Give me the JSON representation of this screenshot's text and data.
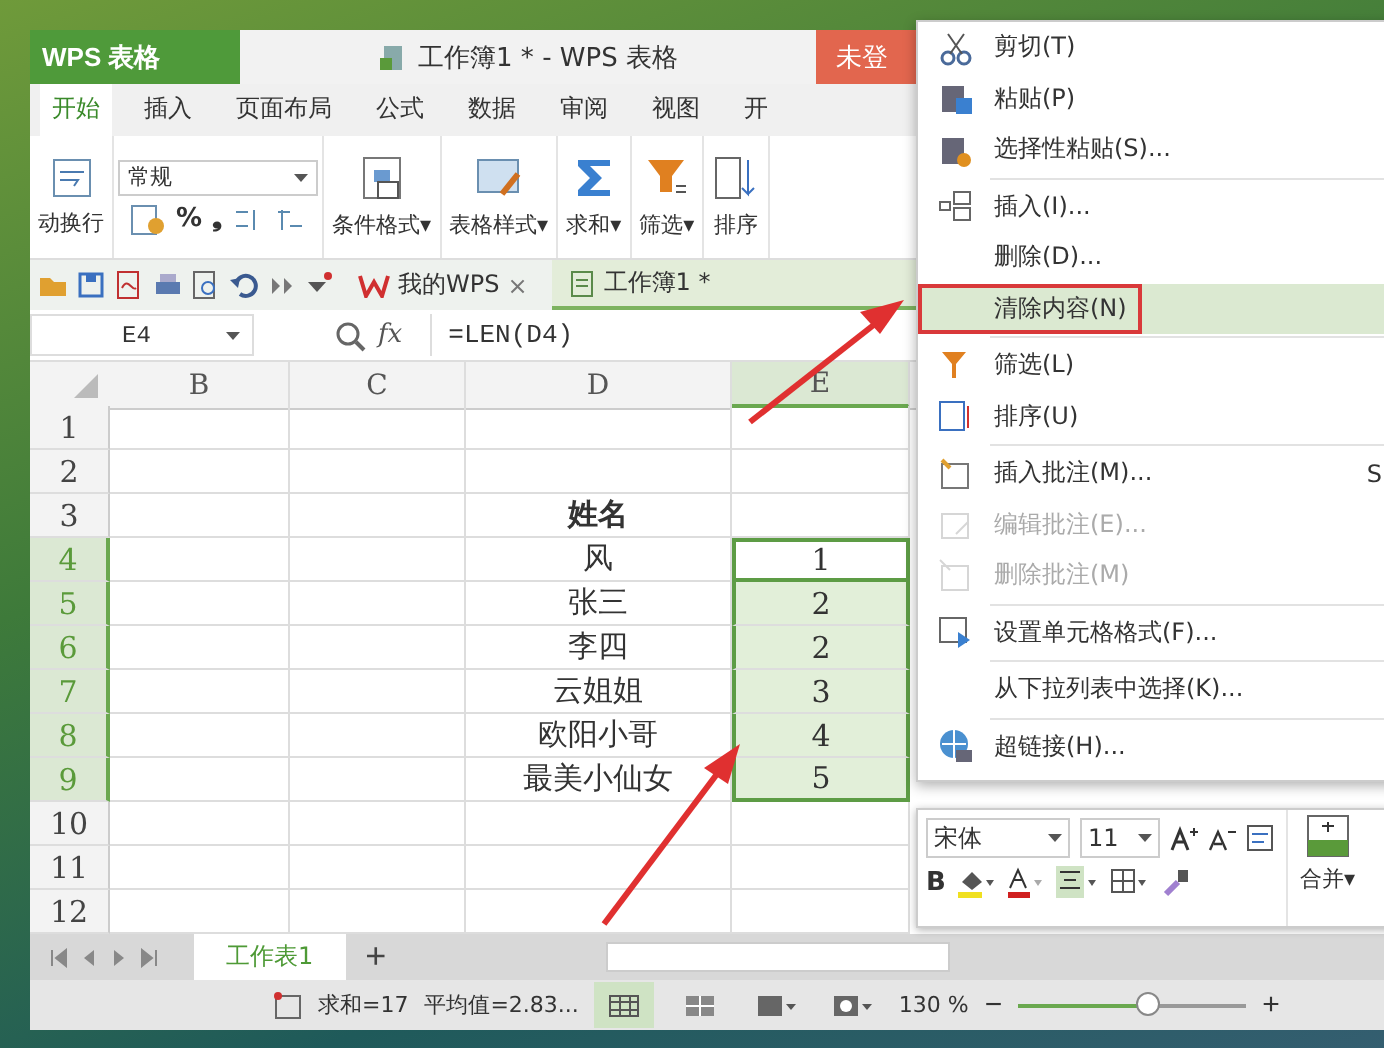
{
  "app": {
    "name": "WPS 表格",
    "title": "工作簿1 * - WPS 表格",
    "login": "未登"
  },
  "ribbon_tabs": [
    {
      "label": "开始",
      "selected": true
    },
    {
      "label": "插入",
      "selected": false
    },
    {
      "label": "页面布局",
      "selected": false
    },
    {
      "label": "公式",
      "selected": false
    },
    {
      "label": "数据",
      "selected": false
    },
    {
      "label": "审阅",
      "selected": false
    },
    {
      "label": "视图",
      "selected": false
    },
    {
      "label": "开",
      "selected": false
    }
  ],
  "ribbon": {
    "wrap": "动换行",
    "number_format": "常规",
    "percent": "%",
    "comma": "❟",
    "commands": [
      {
        "label": "条件格式▾"
      },
      {
        "label": "表格样式▾"
      },
      {
        "label": "求和▾"
      },
      {
        "label": "筛选▾"
      },
      {
        "label": "排序"
      }
    ]
  },
  "doc_tabs": [
    {
      "label": "我的WPS",
      "selected": false,
      "close": "×"
    },
    {
      "label": "工作簿1 *",
      "selected": true
    }
  ],
  "formula_bar": {
    "cell": "E4",
    "fx": "fx",
    "formula": "=LEN(D4)"
  },
  "sheet": {
    "columns": [
      {
        "label": "B",
        "selected": false
      },
      {
        "label": "C",
        "selected": false
      },
      {
        "label": "D",
        "selected": false
      },
      {
        "label": "E",
        "selected": true
      }
    ],
    "rows": [
      {
        "label": "1",
        "selected": false,
        "e_active": false
      },
      {
        "label": "2",
        "selected": false,
        "e_active": false
      },
      {
        "label": "3",
        "selected": false,
        "e_active": false,
        "column_d": "姓名",
        "bold": true
      },
      {
        "label": "4",
        "selected": true,
        "e_active": true,
        "column_d": "风",
        "column_e": "1",
        "bold": false
      },
      {
        "label": "5",
        "selected": true,
        "e_active": false,
        "column_d": "张三",
        "column_e": "2",
        "bold": false
      },
      {
        "label": "6",
        "selected": true,
        "e_active": false,
        "column_d": "李四",
        "column_e": "2",
        "bold": false
      },
      {
        "label": "7",
        "selected": true,
        "e_active": false,
        "column_d": "云姐姐",
        "column_e": "3",
        "bold": false
      },
      {
        "label": "8",
        "selected": true,
        "e_active": false,
        "column_d": "欧阳小哥",
        "column_e": "4",
        "bold": false
      },
      {
        "label": "9",
        "selected": true,
        "e_active": false,
        "column_d": "最美小仙女",
        "column_e": "5",
        "bold": false
      },
      {
        "label": "10",
        "selected": false,
        "e_active": false
      },
      {
        "label": "11",
        "selected": false,
        "e_active": false
      },
      {
        "label": "12",
        "selected": false,
        "e_active": false
      }
    ]
  },
  "sheet_tabs": [
    {
      "label": "工作表1",
      "selected": true
    }
  ],
  "add_sheet": "+",
  "status_bar": {
    "sum": "求和=17",
    "average": "平均值=2.83...",
    "zoom": "130 %",
    "zoom_out": "−",
    "zoom_in": "+",
    "zoom_slider": {
      "level": 0.57
    }
  },
  "context_menu": {
    "items": [
      {
        "kind": "item",
        "label": "剪切(T)",
        "disabled": false,
        "highlighted": false
      },
      {
        "kind": "item",
        "label": "粘贴(P)",
        "disabled": false,
        "highlighted": false
      },
      {
        "kind": "item",
        "label": "选择性粘贴(S)...",
        "disabled": false,
        "highlighted": false
      },
      {
        "kind": "separator"
      },
      {
        "kind": "item",
        "label": "插入(I)...",
        "disabled": false,
        "highlighted": false
      },
      {
        "kind": "item",
        "label": "删除(D)...",
        "disabled": false,
        "highlighted": false
      },
      {
        "kind": "item",
        "label": "清除内容(N)",
        "disabled": false,
        "highlighted": true,
        "boxed": true
      },
      {
        "kind": "separator"
      },
      {
        "kind": "item",
        "label": "筛选(L)",
        "disabled": false,
        "highlighted": false
      },
      {
        "kind": "item",
        "label": "排序(U)",
        "disabled": false,
        "highlighted": false
      },
      {
        "kind": "separator"
      },
      {
        "kind": "item",
        "label": "插入批注(M)...",
        "shortcut": "S",
        "disabled": false,
        "highlighted": false
      },
      {
        "kind": "item",
        "label": "编辑批注(E)...",
        "disabled": true,
        "highlighted": false
      },
      {
        "kind": "item",
        "label": "删除批注(M)",
        "disabled": true,
        "highlighted": false
      },
      {
        "kind": "separator"
      },
      {
        "kind": "item",
        "label": "设置单元格格式(F)...",
        "disabled": false,
        "highlighted": false
      },
      {
        "kind": "separator"
      },
      {
        "kind": "item",
        "label": "从下拉列表中选择(K)...",
        "disabled": false,
        "highlighted": false
      },
      {
        "kind": "separator"
      },
      {
        "kind": "item",
        "label": "超链接(H)...",
        "disabled": false,
        "highlighted": false
      }
    ]
  },
  "mini_toolbar": {
    "font": "宋体",
    "size": "11",
    "bold": "B",
    "merge": "合并▾"
  }
}
